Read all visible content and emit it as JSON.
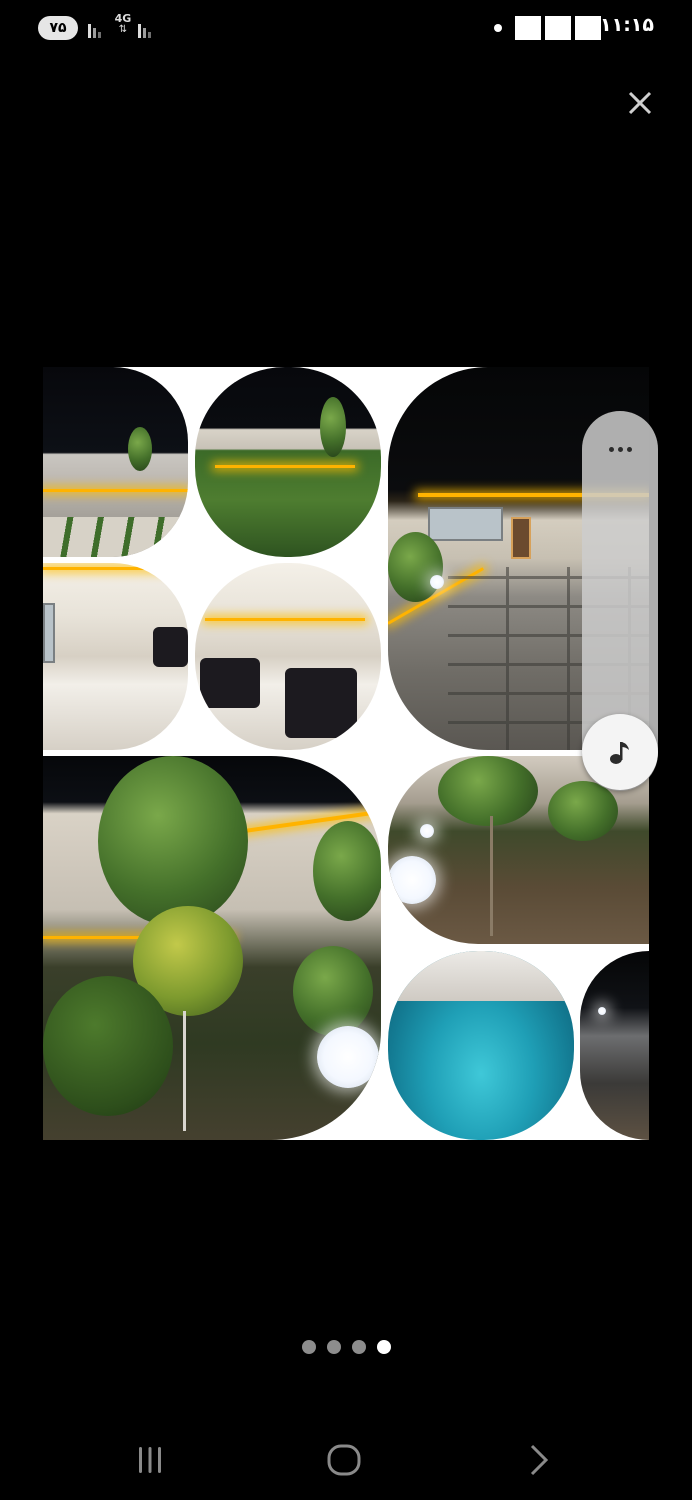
{
  "status_bar": {
    "battery": "۷۵",
    "network": "4G",
    "network_arrows": "⇅",
    "time": "۱۱:۱۵"
  },
  "pager": {
    "total": 4,
    "active_index": 3
  },
  "icons": {
    "close": "close-icon",
    "more": "more-horizontal-icon",
    "music": "music-note-icon",
    "recents": "recent-apps-icon",
    "home": "home-icon",
    "back": "back-icon"
  }
}
